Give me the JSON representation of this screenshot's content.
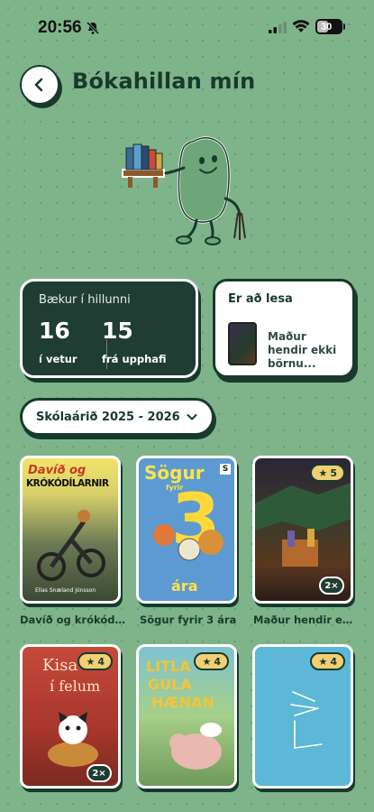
{
  "status_bar": {
    "time": "20:56",
    "battery": "30"
  },
  "header": {
    "title": "Bókahillan mín"
  },
  "stats": {
    "label": "Bækur í hillunni",
    "this_winter": {
      "value": "16",
      "label": "í vetur"
    },
    "since_start": {
      "value": "15",
      "label": "frá upphafi"
    }
  },
  "currently_reading": {
    "label": "Er að lesa",
    "book_title": "Maður hendir ekki börnu..."
  },
  "year_filter": {
    "selected": "Skólaárið 2025 - 2026"
  },
  "books": [
    {
      "caption": "Davíð og krókódí...",
      "cover_text_1": "Davíð og",
      "cover_text_2": "KRÓKÓDÍLARNIR",
      "cover_author": "Elías Snæland Jónsson"
    },
    {
      "caption": "Sögur fyrir 3 ára",
      "cover_text_1": "Sögur",
      "cover_text_2": "fyrir",
      "cover_text_3": "ára"
    },
    {
      "caption": "Maður hendir ek...",
      "rating": "5",
      "count": "2×"
    },
    {
      "caption": "",
      "rating": "4",
      "count": "2×",
      "cover_text_1": "Kisa",
      "cover_text_2": "í felum"
    },
    {
      "caption": "",
      "rating": "4",
      "cover_text_1": "LITLA",
      "cover_text_2": "GULA",
      "cover_text_3": "HÆNAN"
    },
    {
      "caption": "",
      "rating": "4"
    }
  ],
  "colors": {
    "background": "#7fb48a",
    "dark_green": "#1f3d32",
    "accent_yellow": "#f3cf73"
  }
}
